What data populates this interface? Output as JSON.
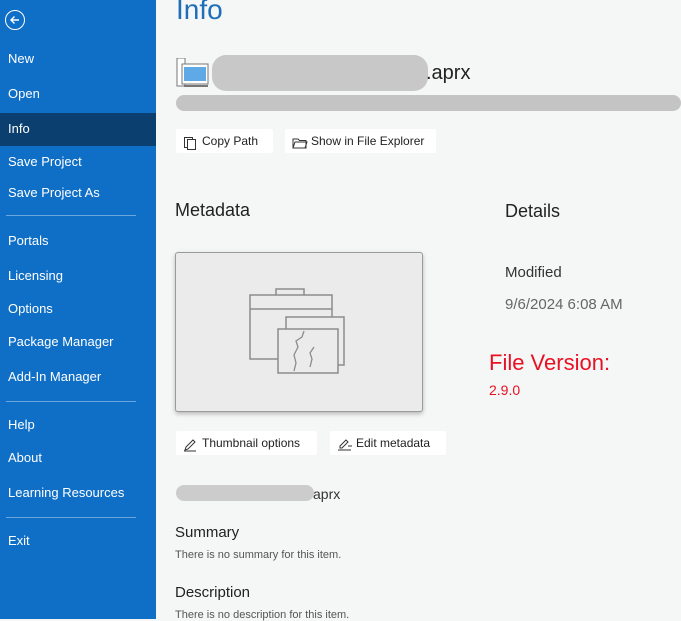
{
  "sidebar": {
    "back_icon": "back-arrow-icon",
    "items": [
      {
        "label": "New"
      },
      {
        "label": "Open"
      },
      {
        "label": "Info"
      },
      {
        "label": "Save Project"
      },
      {
        "label": "Save Project As"
      },
      {
        "label": "Portals"
      },
      {
        "label": "Licensing"
      },
      {
        "label": "Options"
      },
      {
        "label": "Package Manager"
      },
      {
        "label": "Add-In Manager"
      },
      {
        "label": "Help"
      },
      {
        "label": "About"
      },
      {
        "label": "Learning Resources"
      },
      {
        "label": "Exit"
      }
    ]
  },
  "main": {
    "title": "Info",
    "filename_suffix": ".aprx",
    "buttons": {
      "copy_path": "Copy Path",
      "show_in_explorer": "Show in File Explorer",
      "thumbnail_options": "Thumbnail options",
      "edit_metadata": "Edit metadata"
    },
    "metadata_heading": "Metadata",
    "details_heading": "Details",
    "modified_label": "Modified",
    "modified_value": "9/6/2024 6:08 AM",
    "file_version_label": "File Version:",
    "file_version_value": "2.9.0",
    "item_name_suffix": "aprx",
    "summary_heading": "Summary",
    "summary_text": "There is no summary for this item.",
    "description_heading": "Description",
    "description_text": "There is no description for this item."
  },
  "colors": {
    "sidebar_bg": "#0f6fc6",
    "sidebar_active": "#0a3f70",
    "title": "#1e6fb8",
    "file_version": "#e81123"
  }
}
